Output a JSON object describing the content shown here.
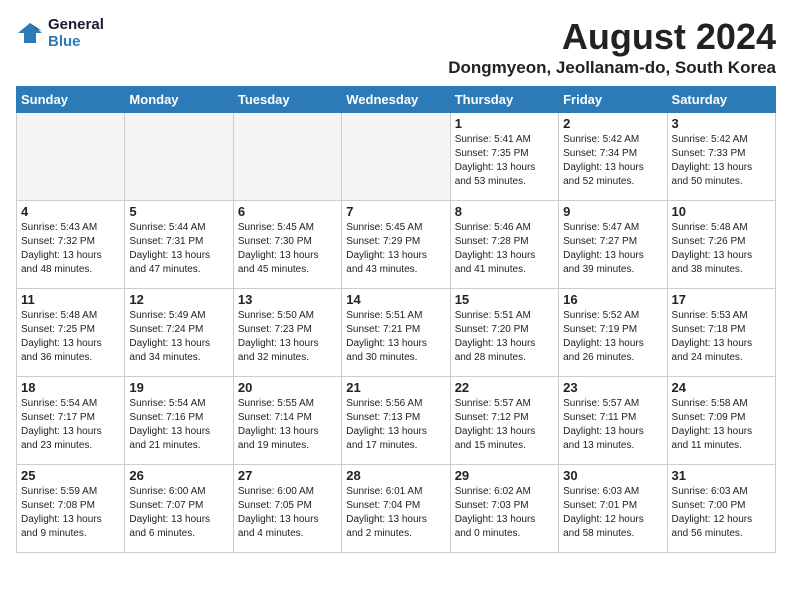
{
  "logo": {
    "line1": "General",
    "line2": "Blue"
  },
  "title": "August 2024",
  "subtitle": "Dongmyeon, Jeollanam-do, South Korea",
  "weekdays": [
    "Sunday",
    "Monday",
    "Tuesday",
    "Wednesday",
    "Thursday",
    "Friday",
    "Saturday"
  ],
  "weeks": [
    [
      {
        "day": "",
        "info": ""
      },
      {
        "day": "",
        "info": ""
      },
      {
        "day": "",
        "info": ""
      },
      {
        "day": "",
        "info": ""
      },
      {
        "day": "1",
        "info": "Sunrise: 5:41 AM\nSunset: 7:35 PM\nDaylight: 13 hours\nand 53 minutes."
      },
      {
        "day": "2",
        "info": "Sunrise: 5:42 AM\nSunset: 7:34 PM\nDaylight: 13 hours\nand 52 minutes."
      },
      {
        "day": "3",
        "info": "Sunrise: 5:42 AM\nSunset: 7:33 PM\nDaylight: 13 hours\nand 50 minutes."
      }
    ],
    [
      {
        "day": "4",
        "info": "Sunrise: 5:43 AM\nSunset: 7:32 PM\nDaylight: 13 hours\nand 48 minutes."
      },
      {
        "day": "5",
        "info": "Sunrise: 5:44 AM\nSunset: 7:31 PM\nDaylight: 13 hours\nand 47 minutes."
      },
      {
        "day": "6",
        "info": "Sunrise: 5:45 AM\nSunset: 7:30 PM\nDaylight: 13 hours\nand 45 minutes."
      },
      {
        "day": "7",
        "info": "Sunrise: 5:45 AM\nSunset: 7:29 PM\nDaylight: 13 hours\nand 43 minutes."
      },
      {
        "day": "8",
        "info": "Sunrise: 5:46 AM\nSunset: 7:28 PM\nDaylight: 13 hours\nand 41 minutes."
      },
      {
        "day": "9",
        "info": "Sunrise: 5:47 AM\nSunset: 7:27 PM\nDaylight: 13 hours\nand 39 minutes."
      },
      {
        "day": "10",
        "info": "Sunrise: 5:48 AM\nSunset: 7:26 PM\nDaylight: 13 hours\nand 38 minutes."
      }
    ],
    [
      {
        "day": "11",
        "info": "Sunrise: 5:48 AM\nSunset: 7:25 PM\nDaylight: 13 hours\nand 36 minutes."
      },
      {
        "day": "12",
        "info": "Sunrise: 5:49 AM\nSunset: 7:24 PM\nDaylight: 13 hours\nand 34 minutes."
      },
      {
        "day": "13",
        "info": "Sunrise: 5:50 AM\nSunset: 7:23 PM\nDaylight: 13 hours\nand 32 minutes."
      },
      {
        "day": "14",
        "info": "Sunrise: 5:51 AM\nSunset: 7:21 PM\nDaylight: 13 hours\nand 30 minutes."
      },
      {
        "day": "15",
        "info": "Sunrise: 5:51 AM\nSunset: 7:20 PM\nDaylight: 13 hours\nand 28 minutes."
      },
      {
        "day": "16",
        "info": "Sunrise: 5:52 AM\nSunset: 7:19 PM\nDaylight: 13 hours\nand 26 minutes."
      },
      {
        "day": "17",
        "info": "Sunrise: 5:53 AM\nSunset: 7:18 PM\nDaylight: 13 hours\nand 24 minutes."
      }
    ],
    [
      {
        "day": "18",
        "info": "Sunrise: 5:54 AM\nSunset: 7:17 PM\nDaylight: 13 hours\nand 23 minutes."
      },
      {
        "day": "19",
        "info": "Sunrise: 5:54 AM\nSunset: 7:16 PM\nDaylight: 13 hours\nand 21 minutes."
      },
      {
        "day": "20",
        "info": "Sunrise: 5:55 AM\nSunset: 7:14 PM\nDaylight: 13 hours\nand 19 minutes."
      },
      {
        "day": "21",
        "info": "Sunrise: 5:56 AM\nSunset: 7:13 PM\nDaylight: 13 hours\nand 17 minutes."
      },
      {
        "day": "22",
        "info": "Sunrise: 5:57 AM\nSunset: 7:12 PM\nDaylight: 13 hours\nand 15 minutes."
      },
      {
        "day": "23",
        "info": "Sunrise: 5:57 AM\nSunset: 7:11 PM\nDaylight: 13 hours\nand 13 minutes."
      },
      {
        "day": "24",
        "info": "Sunrise: 5:58 AM\nSunset: 7:09 PM\nDaylight: 13 hours\nand 11 minutes."
      }
    ],
    [
      {
        "day": "25",
        "info": "Sunrise: 5:59 AM\nSunset: 7:08 PM\nDaylight: 13 hours\nand 9 minutes."
      },
      {
        "day": "26",
        "info": "Sunrise: 6:00 AM\nSunset: 7:07 PM\nDaylight: 13 hours\nand 6 minutes."
      },
      {
        "day": "27",
        "info": "Sunrise: 6:00 AM\nSunset: 7:05 PM\nDaylight: 13 hours\nand 4 minutes."
      },
      {
        "day": "28",
        "info": "Sunrise: 6:01 AM\nSunset: 7:04 PM\nDaylight: 13 hours\nand 2 minutes."
      },
      {
        "day": "29",
        "info": "Sunrise: 6:02 AM\nSunset: 7:03 PM\nDaylight: 13 hours\nand 0 minutes."
      },
      {
        "day": "30",
        "info": "Sunrise: 6:03 AM\nSunset: 7:01 PM\nDaylight: 12 hours\nand 58 minutes."
      },
      {
        "day": "31",
        "info": "Sunrise: 6:03 AM\nSunset: 7:00 PM\nDaylight: 12 hours\nand 56 minutes."
      }
    ]
  ]
}
